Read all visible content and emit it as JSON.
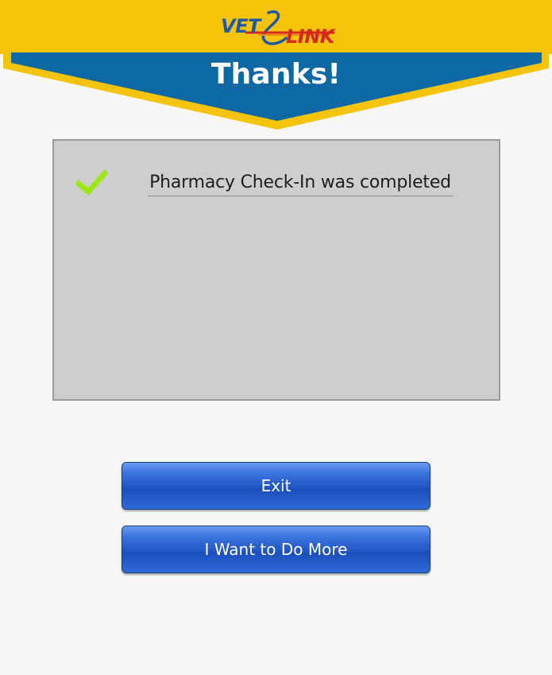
{
  "header": {
    "logo": {
      "part1": "VET",
      "part2": "LINK"
    },
    "title": "Thanks!"
  },
  "result": {
    "icon": "checkmark-icon",
    "message": "Pharmacy Check-In was completed"
  },
  "actions": {
    "exit_label": "Exit",
    "more_label": "I Want to Do More"
  },
  "colors": {
    "header_yellow": "#f5c40a",
    "banner_blue": "#0d68a4",
    "panel_gray": "#cecece",
    "button_blue": "#2459c7",
    "check_green": "#9ee51a",
    "logo_blue": "#1f5aa6",
    "logo_red": "#d8281b"
  }
}
